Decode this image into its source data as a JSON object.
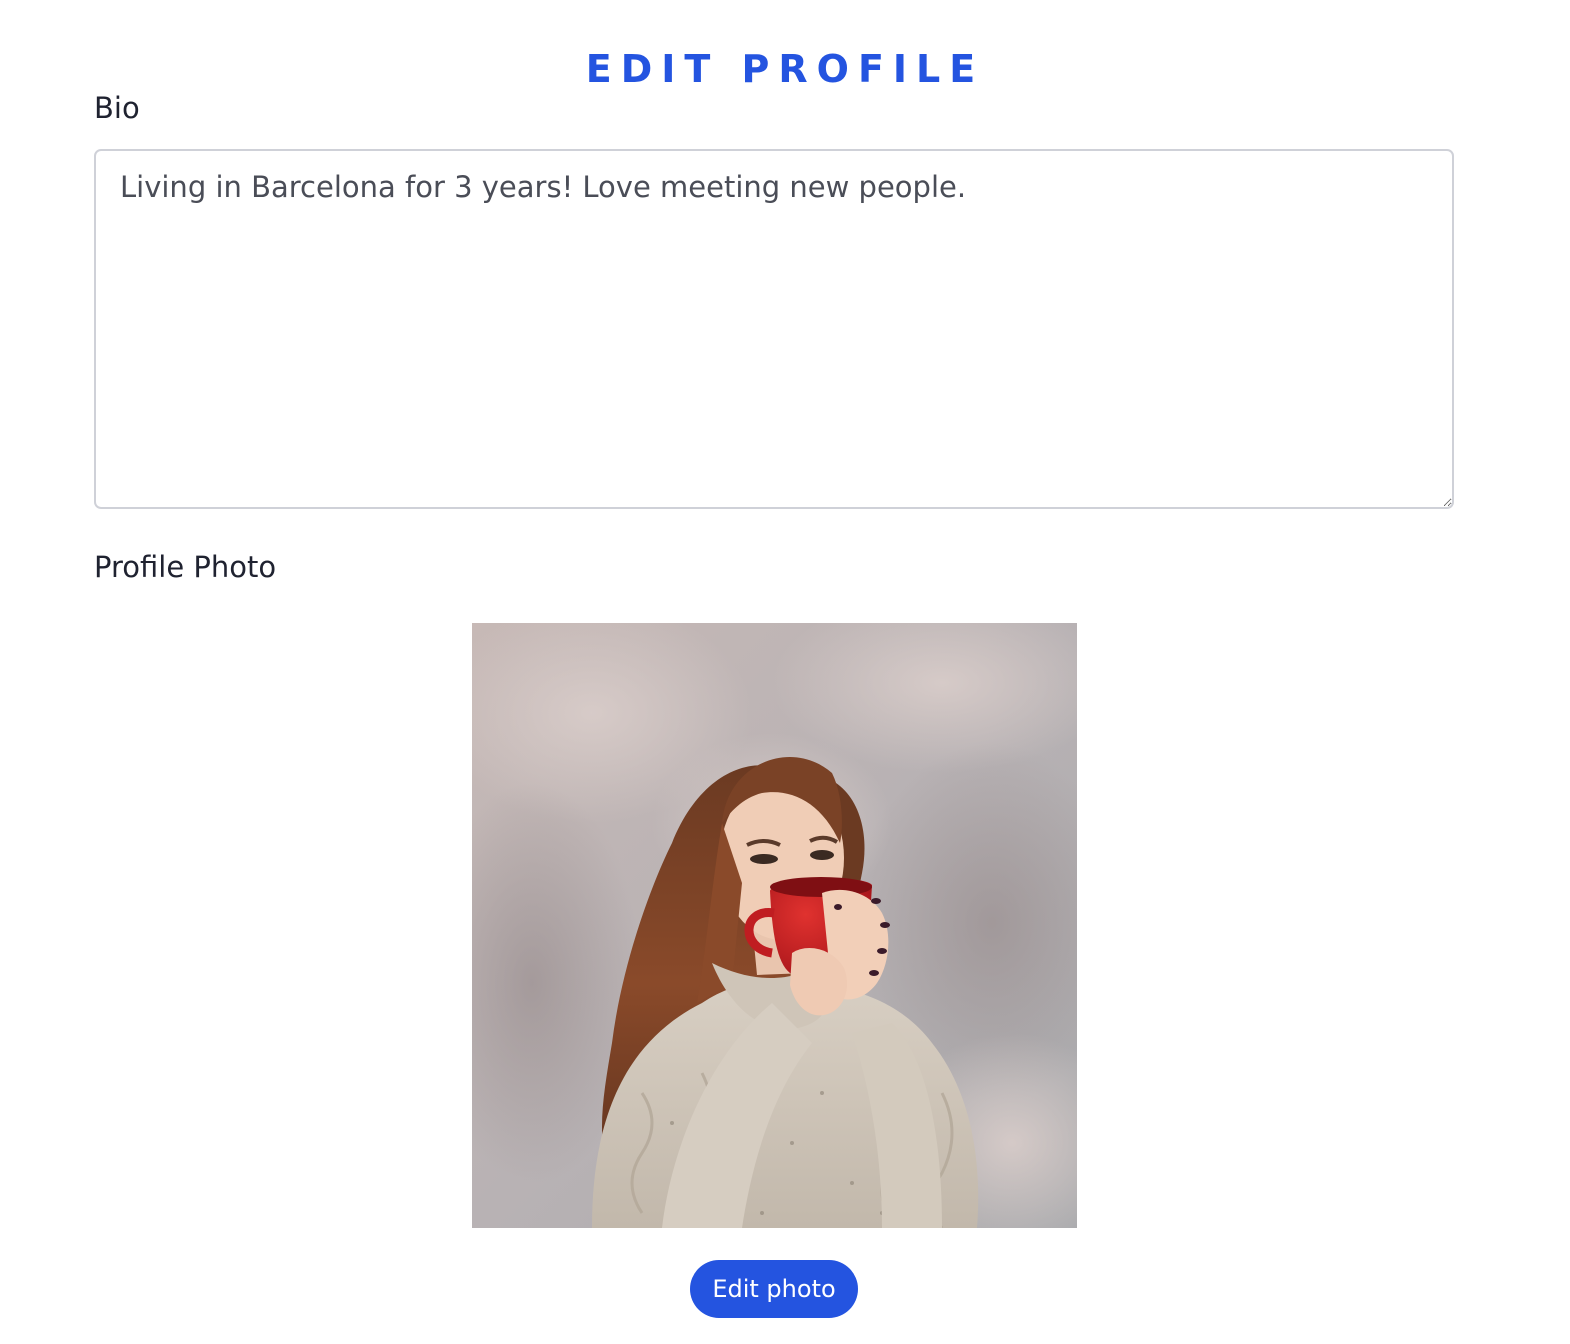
{
  "page": {
    "title": "EDIT PROFILE"
  },
  "bio": {
    "label": "Bio",
    "value": "Living in Barcelona for 3 years! Love meeting new people."
  },
  "profile_photo": {
    "label": "Profile Photo",
    "alt": "Profile photo of a woman with long auburn hair in a cream knit sweater sipping from a red mug",
    "edit_button_label": "Edit photo"
  },
  "colors": {
    "accent": "#2454e0",
    "text": "#1f2230",
    "input_border": "#cfd1d8"
  }
}
